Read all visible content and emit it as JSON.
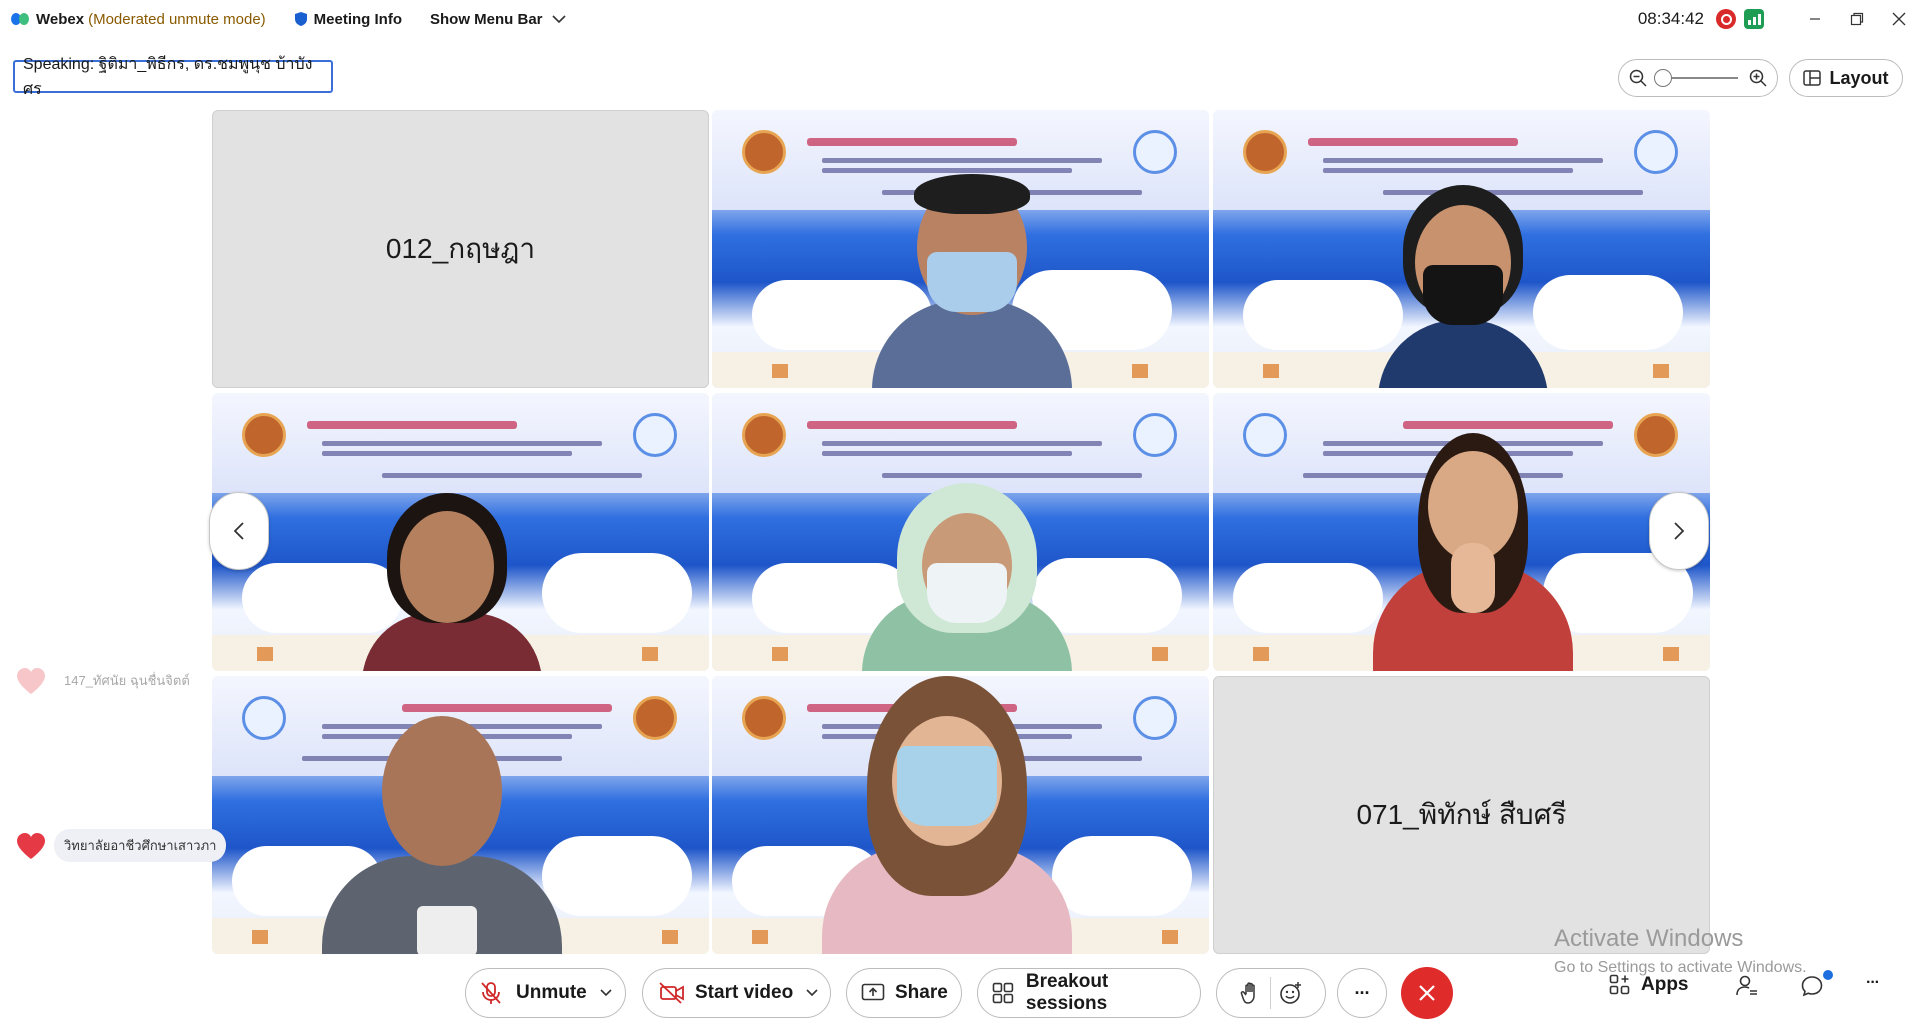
{
  "titlebar": {
    "app_name": "Webex",
    "mode": "(Moderated unmute mode)",
    "meeting_info": "Meeting Info",
    "show_menu_bar": "Show Menu Bar",
    "time": "08:34:42"
  },
  "speaking": "Speaking: ฐิติมา_พิธีกร, ดร.ชมพูนุช บ้าบังศร",
  "layout_label": "Layout",
  "tiles": {
    "t1_name": "012_กฤษฎา",
    "t9_name": "071_พิทักษ์ สืบศรี"
  },
  "reactions": {
    "r1": "147_ทัศนัย ฉุนชื่นจิตต์",
    "r2": "วิทยาลัยอาชีวศึกษาเสาวภา"
  },
  "watermark": {
    "line1": "Activate Windows",
    "line2": "Go to Settings to activate Windows."
  },
  "controls": {
    "unmute": "Unmute",
    "start_video": "Start video",
    "share": "Share",
    "breakout": "Breakout sessions",
    "more": "···",
    "apps": "Apps",
    "overflow": "···"
  },
  "colors": {
    "accent_blue": "#3a6fd8",
    "end_red": "#e02b2b",
    "recording_red": "#d92a2a",
    "network_green": "#1f9d55"
  }
}
